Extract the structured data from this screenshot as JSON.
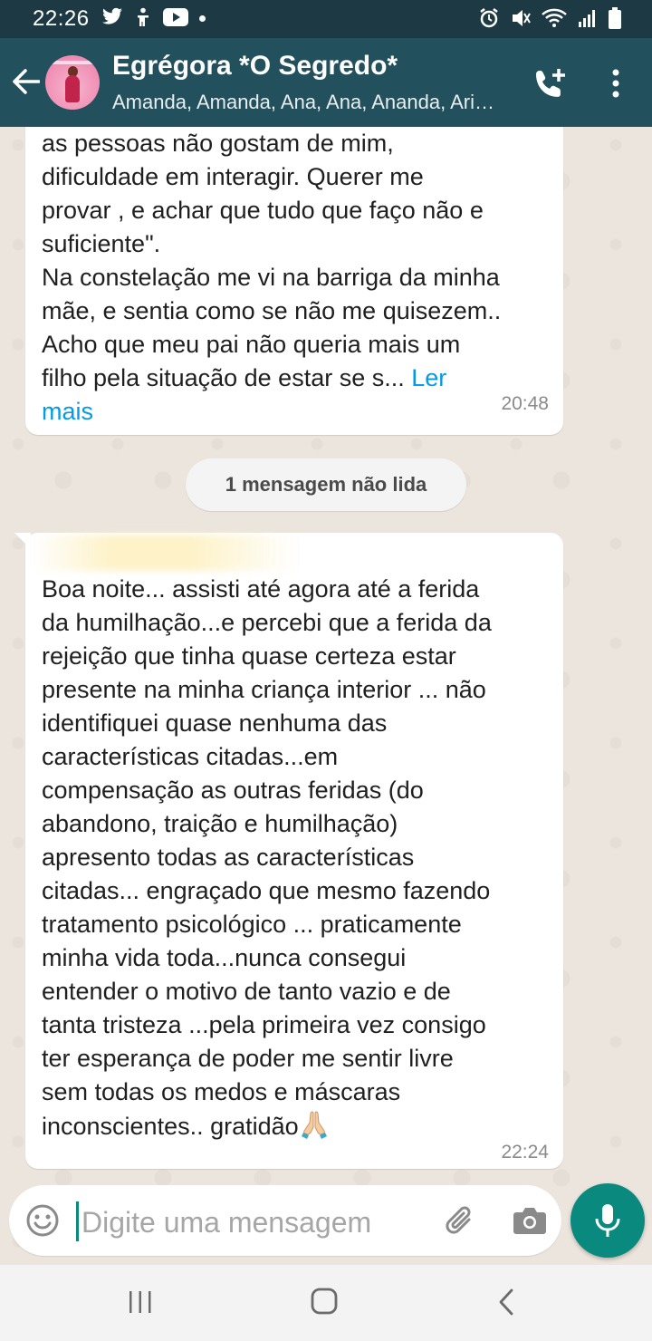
{
  "status_bar": {
    "time": "22:26"
  },
  "header": {
    "title": "Egrégora *O Segredo*",
    "subtitle": "Amanda, Amanda, Ana, Ana, Ananda, Ari…"
  },
  "messages": [
    {
      "text_before": "as pessoas não gostam de mim,\ndificuldade em interagir. Querer me\nprovar , e achar que tudo que faço não e\nsuficiente\".\nNa constelação me vi na barriga da minha\nmãe, e sentia como se não me quisezem..\nAcho que meu pai não queria mais um\nfilho pela situação de estar se s... ",
      "read_more": "Ler\nmais",
      "time": "20:48"
    },
    {
      "text": "Boa noite... assisti até agora  até a ferida\nda humilhação...e percebi que a ferida da\nrejeição  que tinha quase certeza estar\npresente na minha criança interior ... não\nidentifiquei quase nenhuma das\ncaracterísticas citadas...em\ncompensação as outras feridas (do\nabandono, traição e humilhação)\napresento todas as características\ncitadas... engraçado que mesmo fazendo\ntratamento psicológico ... praticamente\nminha vida toda...nunca consegui\nentender o motivo de tanto vazio e de\ntanta tristeza ...pela primeira vez consigo\nter esperança de poder  me sentir livre\nsem todas os medos e máscaras\ninconscientes.. gratidão",
      "time": "22:24"
    }
  ],
  "unread_label": "1 mensagem não lida",
  "input": {
    "placeholder": "Digite uma mensagem",
    "value": ""
  },
  "colors": {
    "header": "#22505c",
    "status_bar": "#1d3a44",
    "accent": "#0a8a7f",
    "link": "#039be5"
  }
}
